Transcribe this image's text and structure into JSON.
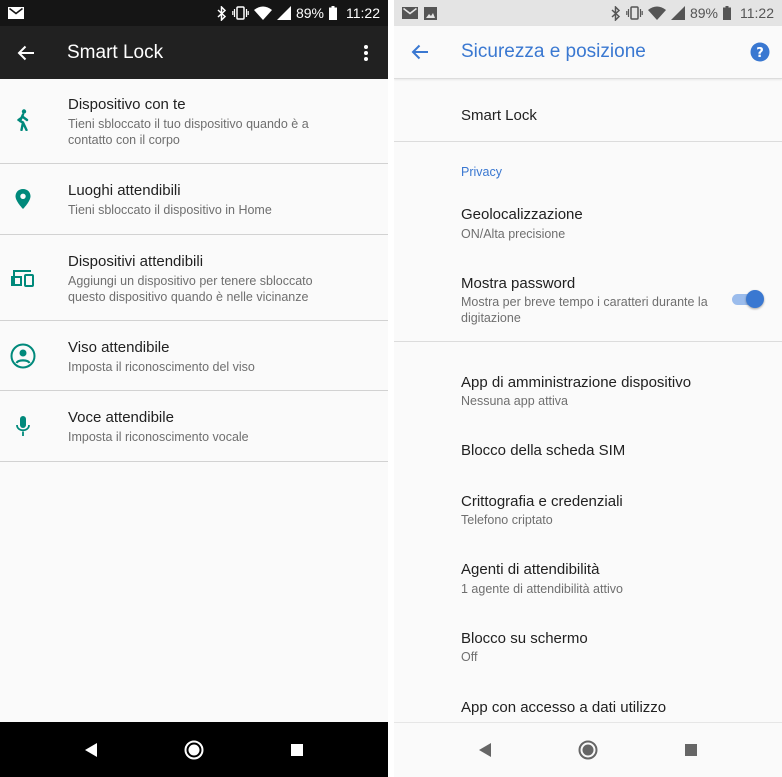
{
  "left": {
    "status": {
      "battery": "89%",
      "time": "11:22"
    },
    "appbar": {
      "title": "Smart Lock"
    },
    "items": [
      {
        "title": "Dispositivo con te",
        "subtitle": "Tieni sbloccato il tuo dispositivo quando è a contatto con il corpo",
        "icon": "walking-person-icon"
      },
      {
        "title": "Luoghi attendibili",
        "subtitle": "Tieni sbloccato il dispositivo in Home",
        "icon": "location-pin-icon"
      },
      {
        "title": "Dispositivi attendibili",
        "subtitle": "Aggiungi un dispositivo per tenere sbloccato questo dispositivo quando è nelle vicinanze",
        "icon": "devices-icon"
      },
      {
        "title": "Viso attendibile",
        "subtitle": "Imposta il riconoscimento del viso",
        "icon": "face-icon"
      },
      {
        "title": "Voce attendibile",
        "subtitle": "Imposta il riconoscimento vocale",
        "icon": "microphone-icon"
      }
    ],
    "colors": {
      "icon": "#00897b",
      "appbar": "#212121",
      "statusbar": "#151515"
    }
  },
  "right": {
    "status": {
      "battery": "89%",
      "time": "11:22"
    },
    "appbar": {
      "title": "Sicurezza e posizione"
    },
    "smart_lock": "Smart Lock",
    "category_privacy": "Privacy",
    "geo": {
      "title": "Geolocalizzazione",
      "subtitle": "ON/Alta precisione"
    },
    "password": {
      "title": "Mostra password",
      "subtitle": "Mostra per breve tempo i caratteri durante la digitazione",
      "enabled": true
    },
    "admin": {
      "title": "App di amministrazione dispositivo",
      "subtitle": "Nessuna app attiva"
    },
    "sim": {
      "title": "Blocco della scheda SIM"
    },
    "crypto": {
      "title": "Crittografia e credenziali",
      "subtitle": "Telefono criptato"
    },
    "agents": {
      "title": "Agenti di attendibilità",
      "subtitle": "1 agente di attendibilità attivo"
    },
    "screen_lock": {
      "title": "Blocco su schermo",
      "subtitle": "Off"
    },
    "usage": {
      "title": "App con accesso a dati utilizzo"
    },
    "colors": {
      "accent": "#3a78d1"
    }
  }
}
